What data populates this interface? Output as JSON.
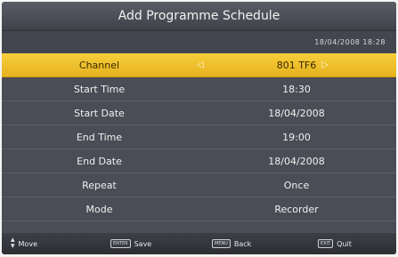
{
  "window": {
    "title": "Add Programme Schedule"
  },
  "datetime": "18/04/2008 18:28",
  "rows": [
    {
      "label": "Channel",
      "value": "801  TF6",
      "selected": true
    },
    {
      "label": "Start Time",
      "value": "18:30"
    },
    {
      "label": "Start Date",
      "value": "18/04/2008"
    },
    {
      "label": "End Time",
      "value": "19:00"
    },
    {
      "label": "End Date",
      "value": "18/04/2008"
    },
    {
      "label": "Repeat",
      "value": "Once"
    },
    {
      "label": "Mode",
      "value": "Recorder"
    }
  ],
  "footer": {
    "move": "Move",
    "save_key": "ENTER",
    "save": "Save",
    "back_key": "MENU",
    "back": "Back",
    "quit_key": "EXIT",
    "quit": "Quit"
  },
  "colors": {
    "panel": "#4a4d55",
    "selected": "#f0c230",
    "background": "#f4f4f4"
  },
  "icons": {
    "left_arrow": "triangle-left-icon",
    "right_arrow": "triangle-right-icon",
    "updown": "up-down-arrows-icon"
  }
}
